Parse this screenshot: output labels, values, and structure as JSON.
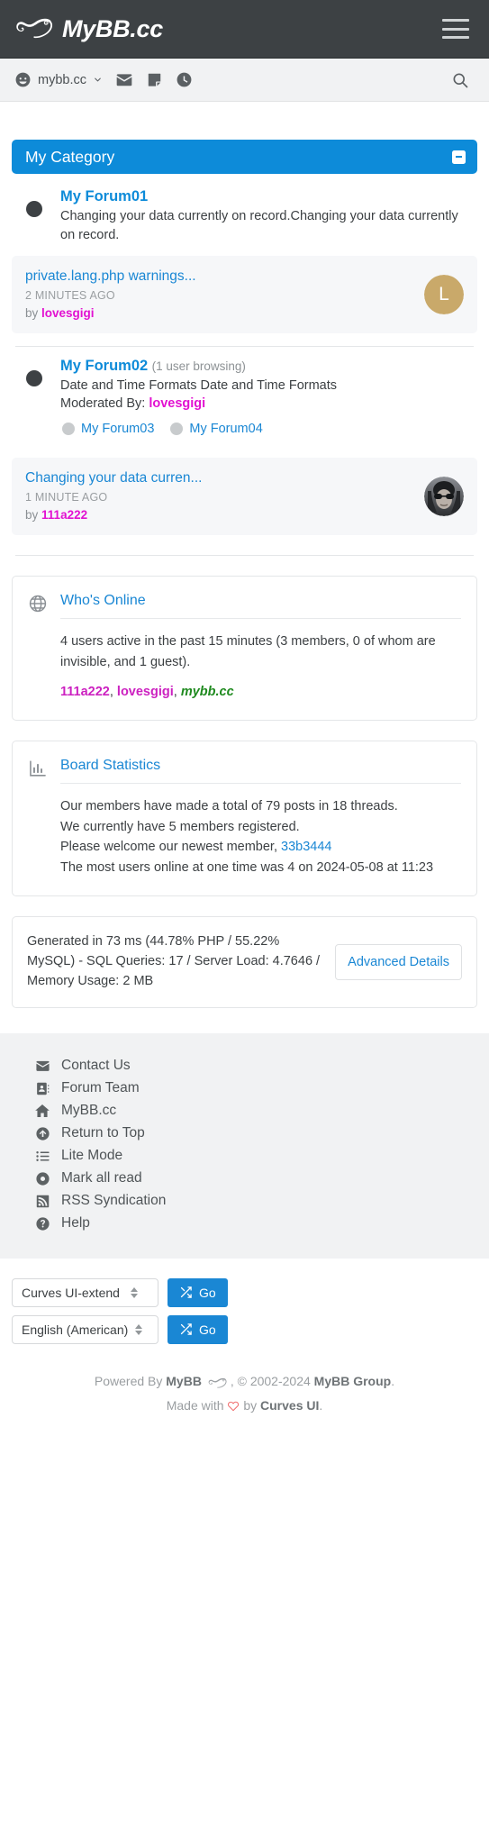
{
  "header": {
    "brand_title": "MyBB.cc",
    "logo_icon": "chameleon-logo",
    "menu_icon": "hamburger-menu-icon"
  },
  "navbar": {
    "user_name": "mybb.cc",
    "user_icon": "smiley-face-icon",
    "chevron_icon": "chevron-down-icon",
    "icons": [
      {
        "name": "envelope-icon",
        "label": "Private Messages"
      },
      {
        "name": "note-icon",
        "label": "Notes"
      },
      {
        "name": "clock-icon",
        "label": "Recent Activity"
      }
    ],
    "search_icon": "search-icon"
  },
  "category": {
    "title": "My Category",
    "collapse_icon": "collapse-minus-icon"
  },
  "forums": [
    {
      "name": "My Forum01",
      "browsing": "",
      "description": "Changing your data currently on record.Changing your data currently on record.",
      "moderated_label": "",
      "moderators": "",
      "subforums": [],
      "last_post": {
        "title": "private.lang.php warnings...",
        "time": "2 MINUTES AGO",
        "by_label": "by",
        "author": "lovesgigi",
        "avatar_type": "letter",
        "avatar_letter": "L",
        "avatar_color": "#c9a96a"
      }
    },
    {
      "name": "My Forum02",
      "browsing": "(1 user browsing)",
      "description": "Date and Time Formats Date and Time Formats",
      "moderated_label": "Moderated By:",
      "moderators": "lovesgigi",
      "subforums": [
        "My Forum03",
        "My Forum04"
      ],
      "last_post": {
        "title": "Changing your data curren...",
        "time": "1 MINUTE AGO",
        "by_label": "by",
        "author": "111a222",
        "avatar_type": "photo",
        "avatar_letter": "",
        "avatar_color": "#3a3a3a"
      }
    }
  ],
  "whos_online": {
    "icon": "globe-icon",
    "title": "Who's Online",
    "summary": "4 users active in the past 15 minutes (3 members, 0 of whom are invisible, and 1 guest).",
    "users": [
      {
        "name": "111a222",
        "style": "magenta"
      },
      {
        "name": "lovesgigi",
        "style": "magenta"
      },
      {
        "name": "mybb.cc",
        "style": "green"
      }
    ]
  },
  "board_statistics": {
    "icon": "bar-chart-icon",
    "title": "Board Statistics",
    "line1": "Our members have made a total of 79 posts in 18 threads.",
    "line2": "We currently have 5 members registered.",
    "line3_prefix": "Please welcome our newest member,",
    "newest_member": "33b3444",
    "line4": "The most users online at one time was 4 on 2024-05-08 at 11:23"
  },
  "generated": {
    "text": "Generated in 73 ms (44.78% PHP / 55.22% MySQL) - SQL Queries: 17 / Server Load: 4.7646 / Memory Usage: 2 MB",
    "advanced_button": "Advanced Details"
  },
  "footer_links": [
    {
      "label": "Contact Us",
      "icon": "envelope-icon"
    },
    {
      "label": "Forum Team",
      "icon": "address-book-icon"
    },
    {
      "label": "MyBB.cc",
      "icon": "home-icon"
    },
    {
      "label": "Return to Top",
      "icon": "arrow-up-circle-icon"
    },
    {
      "label": "Lite Mode",
      "icon": "list-icon"
    },
    {
      "label": "Mark all read",
      "icon": "dot-circle-icon"
    },
    {
      "label": "RSS Syndication",
      "icon": "rss-icon"
    },
    {
      "label": "Help",
      "icon": "question-circle-icon"
    }
  ],
  "footer_forms": [
    {
      "name": "theme-select",
      "value": "Curves UI-extend",
      "go_label": "Go",
      "go_icon": "shuffle-icon"
    },
    {
      "name": "language-select",
      "value": "English (American)",
      "go_label": "Go",
      "go_icon": "shuffle-icon"
    }
  ],
  "copyright": {
    "powered_prefix": "Powered By",
    "powered_brand": "MyBB",
    "logo_icon": "chameleon-logo",
    "years": ", © 2002-2024",
    "group": "MyBB Group",
    "period": ".",
    "made_prefix": "Made with",
    "heart_icon": "heart-icon",
    "made_by": "by",
    "theme_author": "Curves UI",
    "made_period": "."
  },
  "colors": {
    "header_bg": "#3d4144",
    "accent_blue": "#0d8bd9",
    "link_blue": "#1a87d4",
    "magenta": "#e211d1",
    "green": "#1f8a1f",
    "panel_bg": "#f6f7f9"
  }
}
